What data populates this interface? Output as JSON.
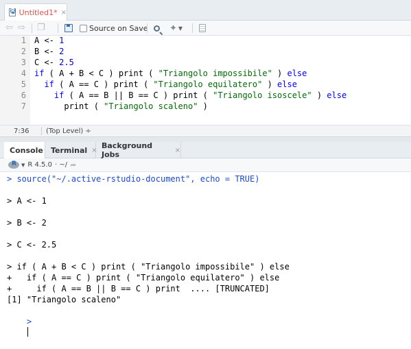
{
  "editor": {
    "tab": {
      "title": "Untitled1*",
      "close": "×"
    },
    "toolbar": {
      "source_on_save": "Source on Save"
    },
    "gutter": [
      "1",
      "2",
      "3",
      "4",
      "5",
      "6",
      "7"
    ],
    "lines": [
      [
        [
          "plain",
          "A <- "
        ],
        [
          "num",
          "1"
        ]
      ],
      [
        [
          "plain",
          "B <- "
        ],
        [
          "num",
          "2"
        ]
      ],
      [
        [
          "plain",
          "C <- "
        ],
        [
          "num",
          "2.5"
        ]
      ],
      [
        [
          "kw",
          "if"
        ],
        [
          "plain",
          " ( A + B < C ) print ( "
        ],
        [
          "str",
          "\"Triangolo impossibile\""
        ],
        [
          "plain",
          " ) "
        ],
        [
          "kw",
          "else"
        ]
      ],
      [
        [
          "plain",
          "  "
        ],
        [
          "kw",
          "if"
        ],
        [
          "plain",
          " ( A == C ) print ( "
        ],
        [
          "str",
          "\"Triangolo equilatero\""
        ],
        [
          "plain",
          " ) "
        ],
        [
          "kw",
          "else"
        ]
      ],
      [
        [
          "plain",
          "    "
        ],
        [
          "kw",
          "if"
        ],
        [
          "plain",
          " ( A == B || B == C ) print ( "
        ],
        [
          "str",
          "\"Triangolo isoscele\""
        ],
        [
          "plain",
          " ) "
        ],
        [
          "kw",
          "else"
        ]
      ],
      [
        [
          "plain",
          "      print ( "
        ],
        [
          "str",
          "\"Triangolo scaleno\""
        ],
        [
          "plain",
          " )"
        ]
      ]
    ],
    "status": {
      "position": "7:36",
      "scope": "(Top Level) ÷"
    }
  },
  "console": {
    "tabs": [
      {
        "label": "Console",
        "close": ""
      },
      {
        "label": "Terminal",
        "close": "×"
      },
      {
        "label": "Background Jobs",
        "close": "×"
      }
    ],
    "header": {
      "version": "R 4.5.0",
      "path": "· ~/"
    },
    "lines": [
      {
        "kind": "cmd",
        "text": "> source(\"~/.active-rstudio-document\", echo = TRUE)"
      },
      {
        "kind": "out",
        "text": ""
      },
      {
        "kind": "out",
        "text": "> A <- 1"
      },
      {
        "kind": "out",
        "text": ""
      },
      {
        "kind": "out",
        "text": "> B <- 2"
      },
      {
        "kind": "out",
        "text": ""
      },
      {
        "kind": "out",
        "text": "> C <- 2.5"
      },
      {
        "kind": "out",
        "text": ""
      },
      {
        "kind": "out",
        "text": "> if ( A + B < C ) print ( \"Triangolo impossibile\" ) else"
      },
      {
        "kind": "out",
        "text": "+   if ( A == C ) print ( \"Triangolo equilatero\" ) else"
      },
      {
        "kind": "out",
        "text": "+     if ( A == B || B == C ) print  .... [TRUNCATED]"
      },
      {
        "kind": "out",
        "text": "[1] \"Triangolo scaleno\""
      }
    ],
    "prompt": ">"
  },
  "colors": {
    "keyword": "#0000ff",
    "string": "#036a07",
    "number": "#0000cd",
    "console_command": "#1a4bd0",
    "unsaved_tab": "#d9534f"
  }
}
